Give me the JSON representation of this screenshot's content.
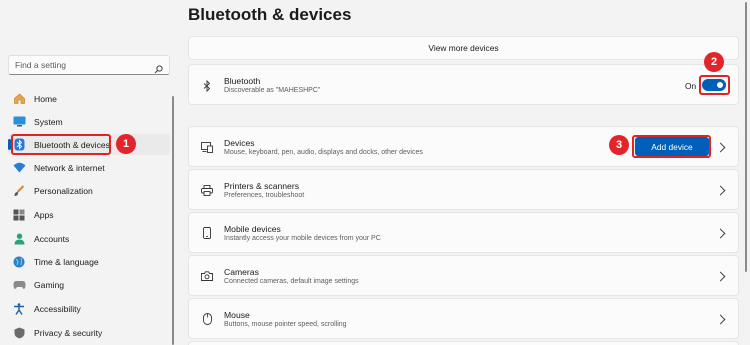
{
  "header": {
    "title": "Bluetooth & devices"
  },
  "search": {
    "placeholder": "Find a setting"
  },
  "sidebar": {
    "items": [
      {
        "label": "Home",
        "icon": "home-icon"
      },
      {
        "label": "System",
        "icon": "system-icon"
      },
      {
        "label": "Bluetooth & devices",
        "icon": "bluetooth-icon",
        "active": true
      },
      {
        "label": "Network & internet",
        "icon": "wifi-icon"
      },
      {
        "label": "Personalization",
        "icon": "brush-icon"
      },
      {
        "label": "Apps",
        "icon": "apps-icon"
      },
      {
        "label": "Accounts",
        "icon": "person-icon"
      },
      {
        "label": "Time & language",
        "icon": "globe-icon"
      },
      {
        "label": "Gaming",
        "icon": "gamepad-icon"
      },
      {
        "label": "Accessibility",
        "icon": "accessibility-icon"
      },
      {
        "label": "Privacy & security",
        "icon": "shield-icon"
      }
    ]
  },
  "annotations": {
    "one": "1",
    "two": "2",
    "three": "3",
    "accent": "#e3242b"
  },
  "main": {
    "view_more": "View more devices",
    "bluetooth": {
      "title": "Bluetooth",
      "subtitle": "Discoverable as \"MAHESHPC\"",
      "state_label": "On",
      "enabled": true
    },
    "devices": {
      "title": "Devices",
      "subtitle": "Mouse, keyboard, pen, audio, displays and docks, other devices",
      "button": "Add device"
    },
    "printers": {
      "title": "Printers & scanners",
      "subtitle": "Preferences, troubleshoot"
    },
    "mobile": {
      "title": "Mobile devices",
      "subtitle": "Instantly access your mobile devices from your PC"
    },
    "cameras": {
      "title": "Cameras",
      "subtitle": "Connected cameras, default image settings"
    },
    "mouse": {
      "title": "Mouse",
      "subtitle": "Buttons, mouse pointer speed, scrolling"
    }
  },
  "colors": {
    "accent": "#005fb8",
    "highlight": "#e02424"
  }
}
